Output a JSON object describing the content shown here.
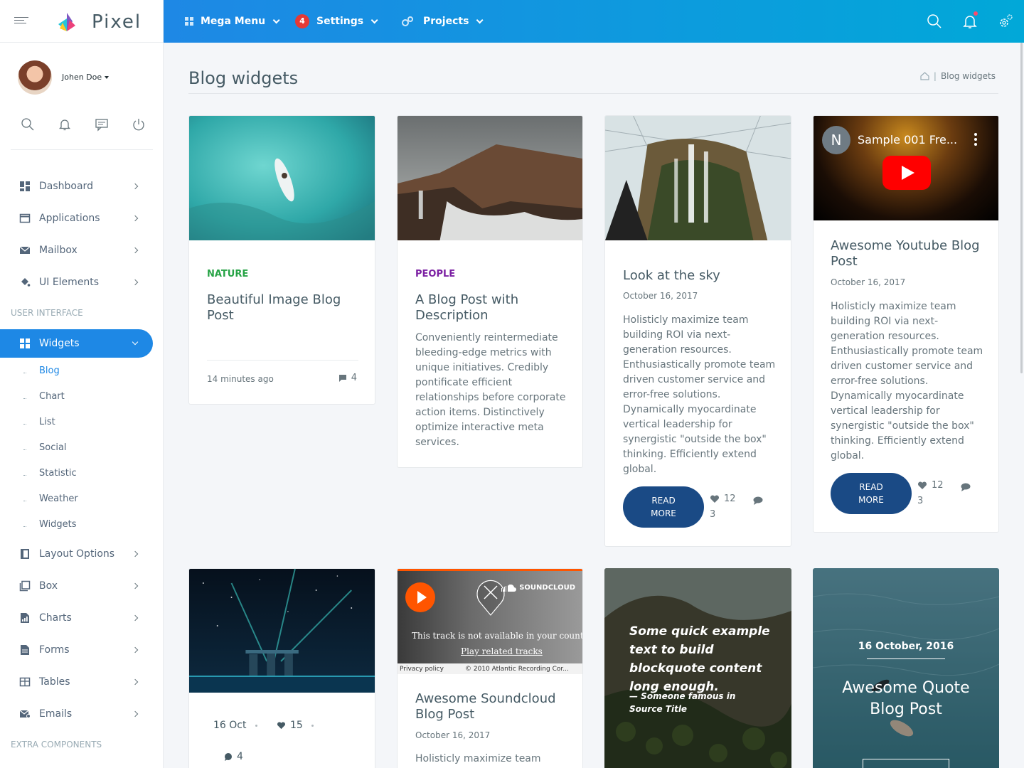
{
  "brand": {
    "name": "Pixel"
  },
  "topnav": {
    "mega_menu": "Mega Menu",
    "settings": "Settings",
    "settings_badge": "4",
    "projects": "Projects"
  },
  "user": {
    "name": "Johen Doe"
  },
  "sidebar": {
    "items_top": [
      {
        "label": "Dashboard",
        "icon": "dashboard-icon"
      },
      {
        "label": "Applications",
        "icon": "window-icon"
      },
      {
        "label": "Mailbox",
        "icon": "mail-icon"
      },
      {
        "label": "UI Elements",
        "icon": "paint-bucket-icon"
      }
    ],
    "cap_ui": "USER INTERFACE",
    "widgets": "Widgets",
    "sub_items": [
      "Blog",
      "Chart",
      "List",
      "Social",
      "Statistic",
      "Weather",
      "Widgets"
    ],
    "items_bottom": [
      {
        "label": "Layout Options",
        "icon": "layout-icon"
      },
      {
        "label": "Box",
        "icon": "box-icon"
      },
      {
        "label": "Charts",
        "icon": "chart-icon"
      },
      {
        "label": "Forms",
        "icon": "form-icon"
      },
      {
        "label": "Tables",
        "icon": "table-icon"
      },
      {
        "label": "Emails",
        "icon": "email-icon"
      }
    ],
    "cap_extra": "EXTRA COMPONENTS"
  },
  "page": {
    "title": "Blog widgets",
    "breadcrumb_current": "Blog widgets"
  },
  "cards": {
    "c1": {
      "tag": "NATURE",
      "title": "Beautiful Image Blog Post",
      "time": "14 minutes ago",
      "comments": "4"
    },
    "c2": {
      "tag": "PEOPLE",
      "title": "A Blog Post with Description",
      "text": "Conveniently reintermediate bleeding-edge metrics with unique initiatives. Credibly pontificate efficient relationships before corporate action items. Distinctively optimize interactive meta services."
    },
    "c3": {
      "title": "Look at the sky",
      "date": "October 16, 2017",
      "text": "Holisticly maximize team building ROI via next-generation resources. Enthusiastically promote team driven customer service and error-free solutions. Dynamically myocardinate vertical leadership for synergistic \"outside the box\" thinking. Efficiently extend global.",
      "button": "READ MORE",
      "likes": "12",
      "comments": "3"
    },
    "c4": {
      "video_title": "Sample 001 Fre...",
      "video_avatar": "N",
      "title": "Awesome Youtube Blog Post",
      "date": "October 16, 2017",
      "text": "Holisticly maximize team building ROI via next-generation resources. Enthusiastically promote team driven customer service and error-free solutions. Dynamically myocardinate vertical leadership for synergistic \"outside the box\" thinking. Efficiently extend global.",
      "button": "READ MORE",
      "likes": "12",
      "comments": "3"
    },
    "c5": {
      "date": "16 Oct",
      "likes": "15",
      "comments": "4"
    },
    "c6": {
      "sc_brand": "SOUNDCLOUD",
      "sc_unavailable": "This track is not available in your country",
      "sc_related": "Play related tracks",
      "sc_privacy": "Privacy policy",
      "sc_copyright": "© 2010 Atlantic Recording Cor...",
      "title": "Awesome Soundcloud Blog Post",
      "date": "October 16, 2017",
      "text": "Holisticly maximize team"
    },
    "c7": {
      "quote": "Some quick example text to build blockquote content long enough.",
      "source": "— Someone famous in Source Title"
    },
    "c8": {
      "date": "16 October, 2016",
      "title": "Awesome Quote Blog Post"
    }
  },
  "colors": {
    "primary": "#1e88e5",
    "nature": "#26a345",
    "people": "#7b1fa2",
    "button": "#1a4a85"
  }
}
